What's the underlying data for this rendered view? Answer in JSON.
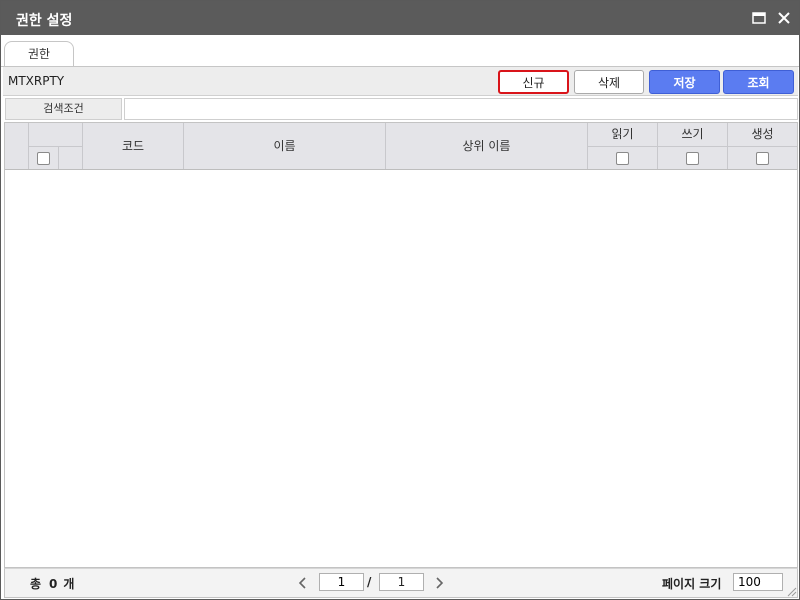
{
  "window": {
    "title": "권한 설정",
    "maximize_icon": "maximize-icon",
    "close_icon": "close-icon"
  },
  "tabs": [
    {
      "label": "권한",
      "active": true
    }
  ],
  "toolbar": {
    "code": "MTXRPTY",
    "new_label": "신규",
    "delete_label": "삭제",
    "save_label": "저장",
    "query_label": "조회",
    "accent_color": "#5b7cf1",
    "focus_color": "#d9141a"
  },
  "search": {
    "label": "검색조건",
    "value": "",
    "placeholder": ""
  },
  "grid": {
    "columns": {
      "code": "코드",
      "name": "이름",
      "parent_name": "상위 이름",
      "read": "읽기",
      "write": "쓰기",
      "create": "생성"
    },
    "rows": []
  },
  "footer": {
    "total_prefix": "총",
    "total_count": "0",
    "total_suffix": "개",
    "current_page": "1",
    "page_separator": "/",
    "total_pages": "1",
    "page_size_label": "페이지 크기",
    "page_size": "100"
  }
}
